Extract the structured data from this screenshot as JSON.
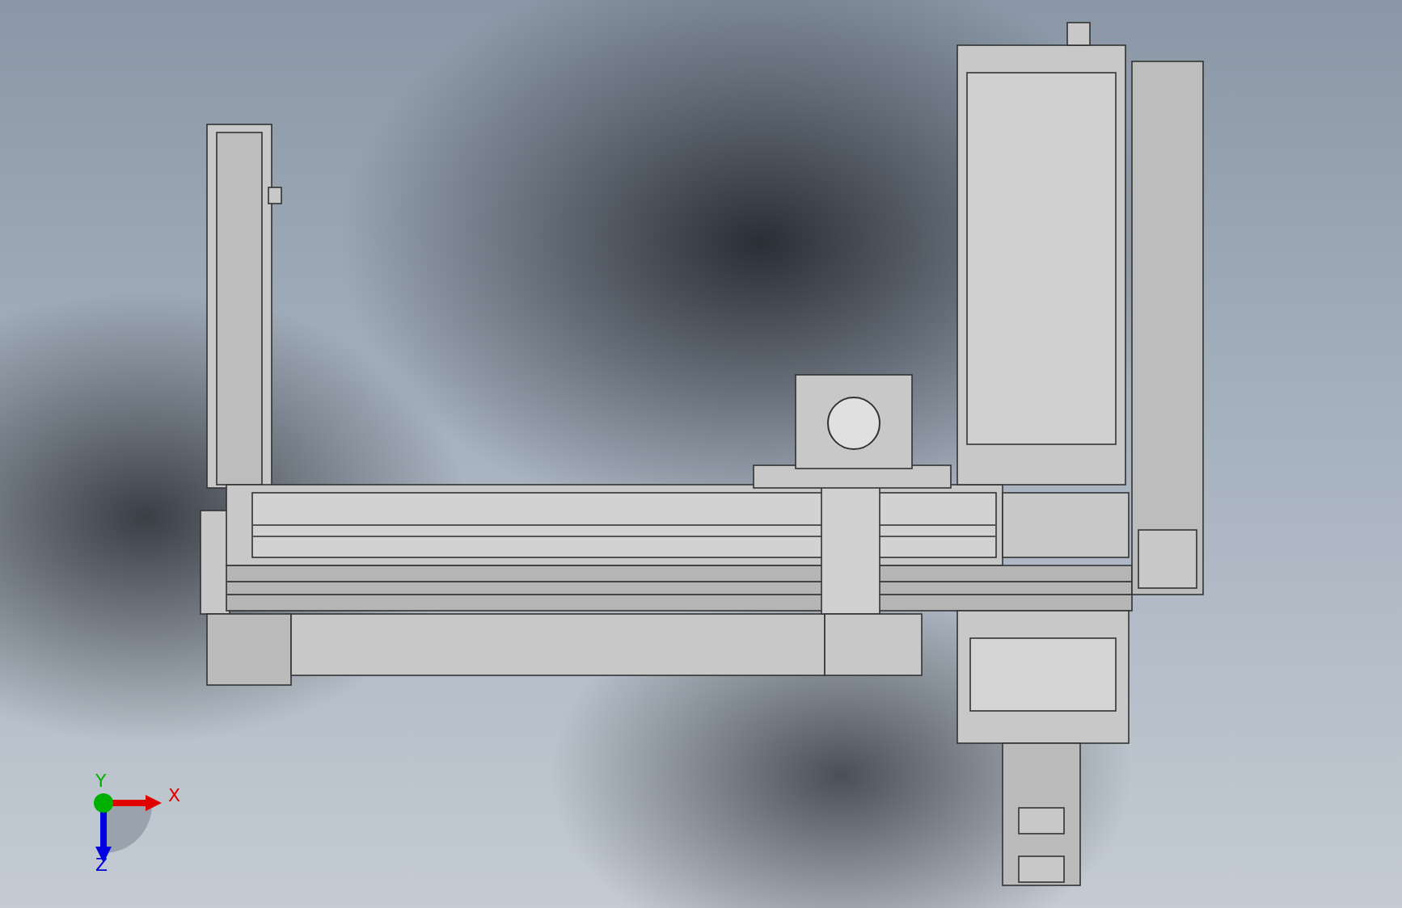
{
  "viewport": {
    "axes": [
      {
        "label": "X",
        "color": "#e00000"
      },
      {
        "label": "Y",
        "color": "#00b000"
      },
      {
        "label": "Z",
        "color": "#0000e0"
      }
    ]
  }
}
